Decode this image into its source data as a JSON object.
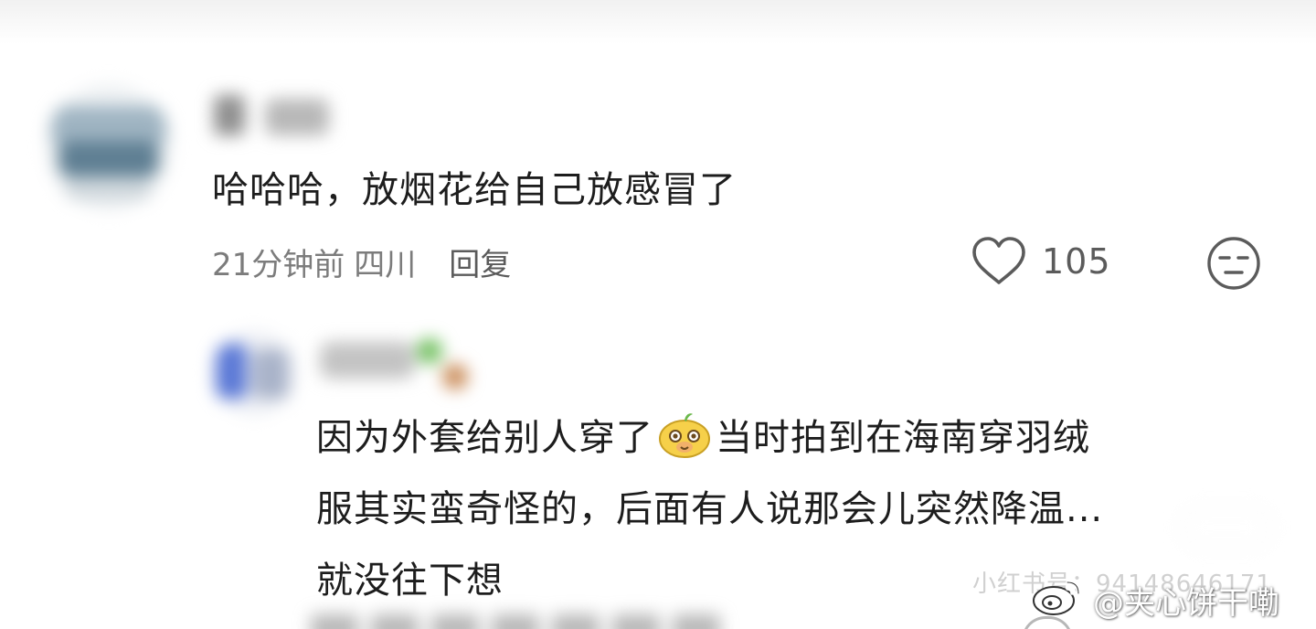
{
  "comment": {
    "text": "哈哈哈，放烟花给自己放感冒了",
    "time": "21分钟前",
    "location": "四川",
    "reply_label": "回复",
    "like_count": "105"
  },
  "reply": {
    "line1_before_emoji": "因为外套给别人穿了",
    "line1_after_emoji": "当时拍到在海南穿羽绒",
    "line2": "服其实蛮奇怪的，后面有人说那会儿突然降温",
    "line2_ellipsis": "...",
    "line3": "就没往下想"
  },
  "watermarks": {
    "platform_id": "小红书号：94148646171",
    "weibo_handle": "@夹心饼干嘞"
  },
  "colors": {
    "text_primary": "#1d1d1d",
    "text_secondary": "#7c7c7c",
    "icon_gray": "#5b5b5b",
    "background": "#ffffff"
  },
  "icons": {
    "like": "heart-outline-icon",
    "dislike": "neutral-face-icon",
    "emoji": "cartoon-sticker-emoji",
    "weibo": "weibo-logo-icon"
  }
}
